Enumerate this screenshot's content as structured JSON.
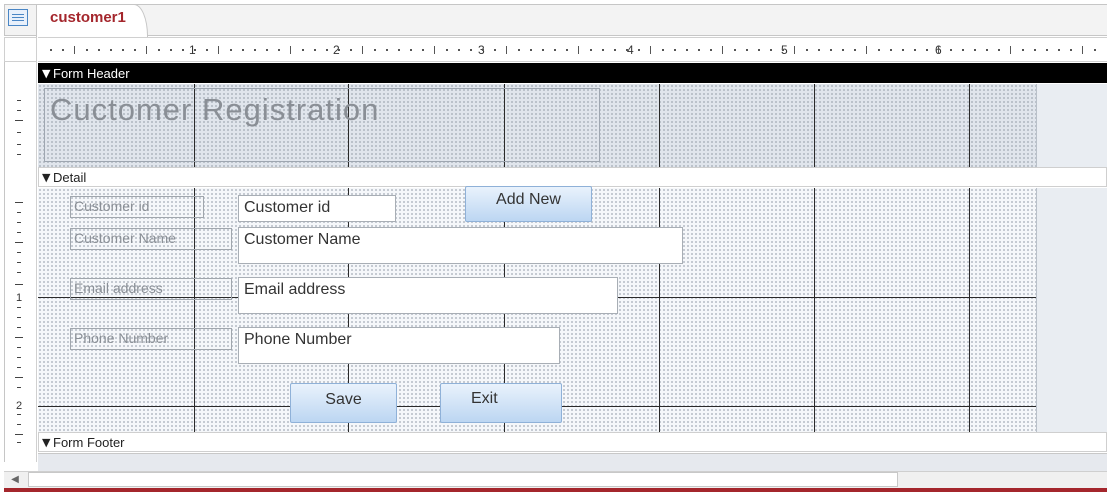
{
  "tab": {
    "title": "customer1",
    "icon": "form-icon"
  },
  "ruler": {
    "numbers": [
      "1",
      "2",
      "3",
      "4",
      "5",
      "6"
    ]
  },
  "vruler": {
    "numbers": [
      "1",
      "2"
    ]
  },
  "sections": {
    "header": "Form Header",
    "detail": "Detail",
    "footer": "Form Footer"
  },
  "header": {
    "title": "Cuctomer Registration"
  },
  "fields": [
    {
      "label": "Customer id",
      "value": "Customer id"
    },
    {
      "label": "Customer Name",
      "value": "Customer Name"
    },
    {
      "label": "Email address",
      "value": "Email address"
    },
    {
      "label": "Phone Number",
      "value": "Phone Number"
    }
  ],
  "buttons": {
    "add_new": "Add New",
    "save": "Save",
    "exit": "Exit"
  },
  "colors": {
    "accent": "#a4262c",
    "section_header": "#000000",
    "button": "#bcd6f2"
  }
}
